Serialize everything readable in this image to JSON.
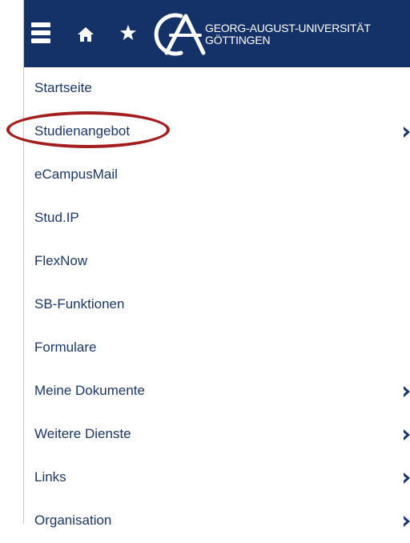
{
  "header": {
    "menu_icon": "hamburger-menu-icon",
    "home_icon": "home-icon",
    "favorite_icon": "star-icon",
    "logo_icon": "university-logo-icon",
    "university_line1": "GEORG-AUGUST-UNIVERSITÄT",
    "university_line2": "GÖTTINGEN",
    "background_color": "#153268"
  },
  "menu": {
    "items": [
      {
        "label": "Startseite",
        "has_submenu": false
      },
      {
        "label": "Studienangebot",
        "has_submenu": true,
        "highlighted": true
      },
      {
        "label": "eCampusMail",
        "has_submenu": false
      },
      {
        "label": "Stud.IP",
        "has_submenu": false
      },
      {
        "label": "FlexNow",
        "has_submenu": false
      },
      {
        "label": "SB-Funktionen",
        "has_submenu": false
      },
      {
        "label": "Formulare",
        "has_submenu": false
      },
      {
        "label": "Meine Dokumente",
        "has_submenu": true
      },
      {
        "label": "Weitere Dienste",
        "has_submenu": true
      },
      {
        "label": "Links",
        "has_submenu": true
      },
      {
        "label": "Organisation",
        "has_submenu": true
      }
    ],
    "chevron_icon": "chevron-right-icon",
    "text_color": "#1c3767",
    "highlight_color": "#a31e1e"
  }
}
